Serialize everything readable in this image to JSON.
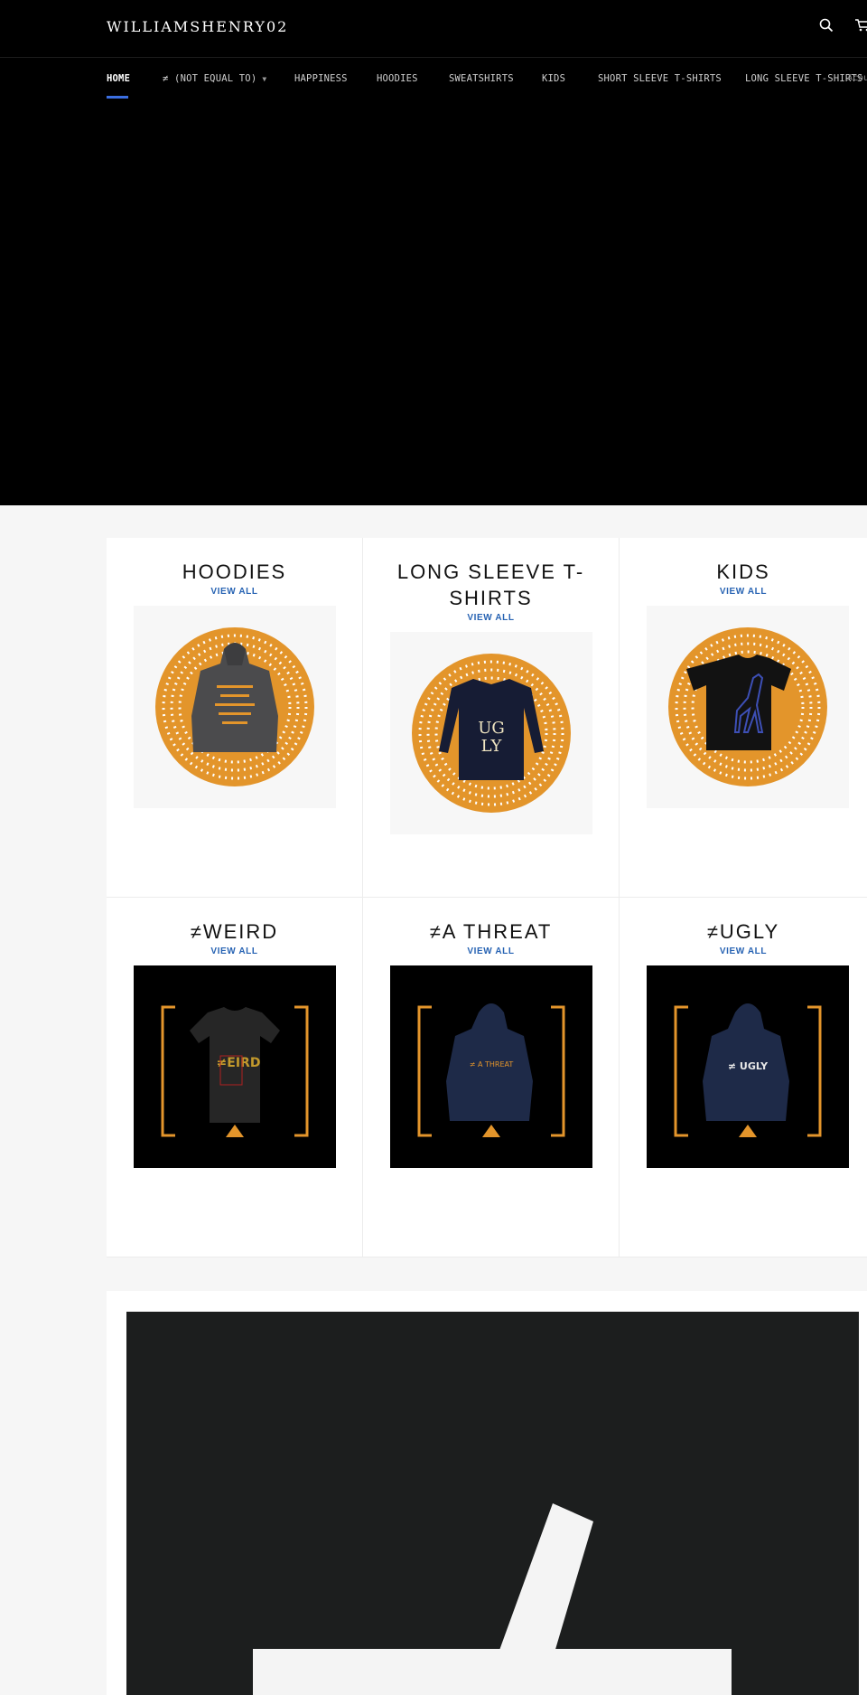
{
  "header": {
    "logo": "WILLIAMSHENRY02",
    "search_icon": "search-icon",
    "cart_icon": "cart-icon"
  },
  "nav": {
    "items": [
      {
        "label": "HOME",
        "active": true
      },
      {
        "label": "≠ (NOT EQUAL TO)",
        "has_dropdown": true
      },
      {
        "label": "HAPPINESS"
      },
      {
        "label": "HOODIES"
      },
      {
        "label": "SWEATSHIRTS"
      },
      {
        "label": "KIDS"
      },
      {
        "label": "SHORT SLEEVE T-SHIRTS"
      },
      {
        "label": "LONG SLEEVE T-SHIRTS"
      }
    ],
    "overflow_text": "Acou"
  },
  "collections": [
    {
      "title": "HOODIES",
      "link": "VIEW ALL",
      "image": "gray hoodie on orange dotted circle"
    },
    {
      "title": "LONG SLEEVE T-SHIRTS",
      "link": "VIEW ALL",
      "image": "navy long sleeve shirt on orange dotted circle",
      "print": "UG LY"
    },
    {
      "title": "KIDS",
      "link": "VIEW ALL",
      "image": "black kids tee with blue giraffe on orange dotted circle"
    },
    {
      "title": "≠WEIRD",
      "link": "VIEW ALL",
      "image": "black tee with weird print in orange brackets",
      "print": "≠ EIRD"
    },
    {
      "title": "≠A THREAT",
      "link": "VIEW ALL",
      "image": "navy hoodie in orange brackets",
      "print": "≠ A THREAT"
    },
    {
      "title": "≠UGLY",
      "link": "VIEW ALL",
      "image": "navy hoodie in orange brackets",
      "print": "≠ UGLY"
    }
  ],
  "colors": {
    "accent_orange": "#e3952b",
    "link_blue": "#2763b3",
    "nav_underline": "#3b6ee0",
    "header_bg": "#000000",
    "feature_bg": "#1c1e1e"
  },
  "feature": {
    "image": "large not-equal sign on dark background"
  }
}
